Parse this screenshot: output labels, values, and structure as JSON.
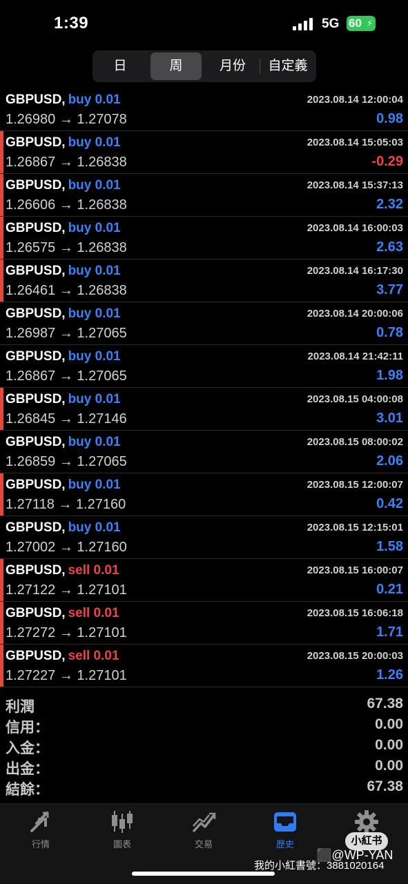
{
  "status": {
    "time": "1:39",
    "network": "5G",
    "battery": "60"
  },
  "period_tabs": [
    {
      "label": "日",
      "active": false
    },
    {
      "label": "周",
      "active": true
    },
    {
      "label": "月份",
      "active": false
    },
    {
      "label": "自定義",
      "active": false
    }
  ],
  "deals": [
    {
      "symbol": "GBPUSD,",
      "type": "buy 0.01",
      "side": "buy",
      "time": "2023.08.14 12:00:04",
      "prices": "1.26980 → 1.27078",
      "profit": "0.98"
    },
    {
      "symbol": "GBPUSD,",
      "type": "buy 0.01",
      "side": "buy",
      "time": "2023.08.14 15:05:03",
      "prices": "1.26867 → 1.26838",
      "profit": "-0.29"
    },
    {
      "symbol": "GBPUSD,",
      "type": "buy 0.01",
      "side": "buy",
      "time": "2023.08.14 15:37:13",
      "prices": "1.26606 → 1.26838",
      "profit": "2.32"
    },
    {
      "symbol": "GBPUSD,",
      "type": "buy 0.01",
      "side": "buy",
      "time": "2023.08.14 16:00:03",
      "prices": "1.26575 → 1.26838",
      "profit": "2.63"
    },
    {
      "symbol": "GBPUSD,",
      "type": "buy 0.01",
      "side": "buy",
      "time": "2023.08.14 16:17:30",
      "prices": "1.26461 → 1.26838",
      "profit": "3.77"
    },
    {
      "symbol": "GBPUSD,",
      "type": "buy 0.01",
      "side": "buy",
      "time": "2023.08.14 20:00:06",
      "prices": "1.26987 → 1.27065",
      "profit": "0.78"
    },
    {
      "symbol": "GBPUSD,",
      "type": "buy 0.01",
      "side": "buy",
      "time": "2023.08.14 21:42:11",
      "prices": "1.26867 → 1.27065",
      "profit": "1.98"
    },
    {
      "symbol": "GBPUSD,",
      "type": "buy 0.01",
      "side": "buy",
      "time": "2023.08.15 04:00:08",
      "prices": "1.26845 → 1.27146",
      "profit": "3.01"
    },
    {
      "symbol": "GBPUSD,",
      "type": "buy 0.01",
      "side": "buy",
      "time": "2023.08.15 08:00:02",
      "prices": "1.26859 → 1.27065",
      "profit": "2.06"
    },
    {
      "symbol": "GBPUSD,",
      "type": "buy 0.01",
      "side": "buy",
      "time": "2023.08.15 12:00:07",
      "prices": "1.27118 → 1.27160",
      "profit": "0.42"
    },
    {
      "symbol": "GBPUSD,",
      "type": "buy 0.01",
      "side": "buy",
      "time": "2023.08.15 12:15:01",
      "prices": "1.27002 → 1.27160",
      "profit": "1.58"
    },
    {
      "symbol": "GBPUSD,",
      "type": "sell 0.01",
      "side": "sell",
      "time": "2023.08.15 16:00:07",
      "prices": "1.27122 → 1.27101",
      "profit": "0.21"
    },
    {
      "symbol": "GBPUSD,",
      "type": "sell 0.01",
      "side": "sell",
      "time": "2023.08.15 16:06:18",
      "prices": "1.27272 → 1.27101",
      "profit": "1.71"
    },
    {
      "symbol": "GBPUSD,",
      "type": "sell 0.01",
      "side": "sell",
      "time": "2023.08.15 20:00:03",
      "prices": "1.27227 → 1.27101",
      "profit": "1.26"
    }
  ],
  "summary": [
    {
      "label": "利潤",
      "value": "67.38"
    },
    {
      "label": "信用：",
      "value": "0.00"
    },
    {
      "label": "入金：",
      "value": "0.00"
    },
    {
      "label": "出金：",
      "value": "0.00"
    },
    {
      "label": "結餘：",
      "value": "67.38"
    }
  ],
  "tab_bar": [
    {
      "label": "行情",
      "icon": "quotes-arrows-icon",
      "active": false
    },
    {
      "label": "圖表",
      "icon": "candlestick-chart-icon",
      "active": false
    },
    {
      "label": "交易",
      "icon": "trade-chart-icon",
      "active": false
    },
    {
      "label": "歷史",
      "icon": "history-inbox-icon",
      "active": true
    },
    {
      "label": "設置",
      "icon": "gear-icon",
      "active": false
    }
  ],
  "watermark": {
    "badge": "小紅书",
    "handle": "@WP-YAN",
    "id_text": "我的小紅書號：3881020164"
  },
  "colors": {
    "buy": "#3b82f6",
    "sell": "#ef4444",
    "profit_positive": "#3b82f6",
    "profit_negative": "#ef4444",
    "stripe_buy_default": "#000000",
    "stripe_highlight": "#e5483b",
    "tab_active": "#2f7cf6"
  },
  "stripes": [
    false,
    true,
    true,
    true,
    true,
    false,
    false,
    true,
    false,
    true,
    false,
    true,
    true,
    true
  ]
}
